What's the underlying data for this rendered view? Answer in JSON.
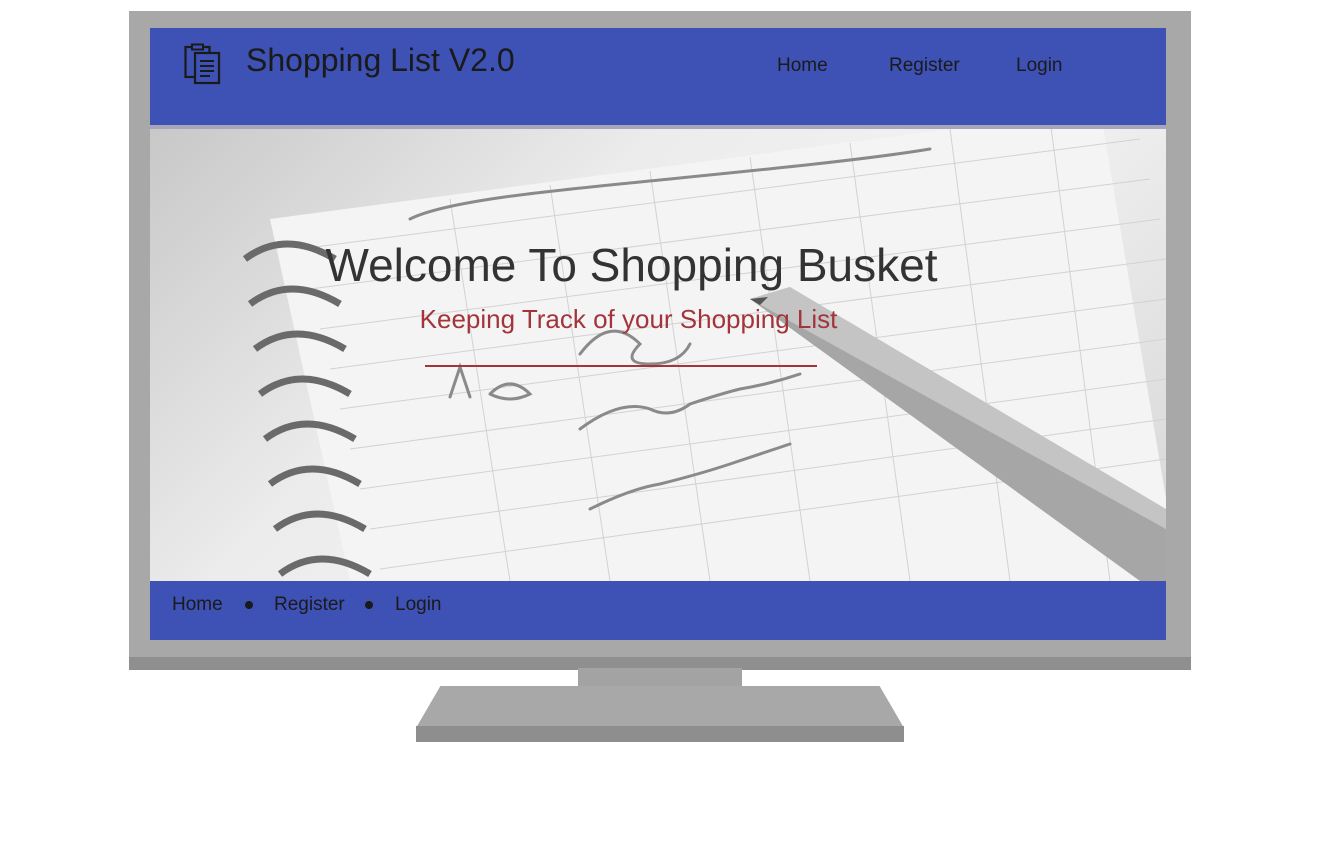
{
  "header": {
    "title": "Shopping List V2.0",
    "logo_icon": "clipboard-list-icon",
    "nav": [
      {
        "label": "Home"
      },
      {
        "label": "Register"
      },
      {
        "label": "Login"
      }
    ]
  },
  "hero": {
    "title": "Welcome To Shopping Busket",
    "subtitle": "Keeping Track of your Shopping List",
    "accent_color": "#a3343a"
  },
  "footer": {
    "nav": [
      {
        "label": "Home"
      },
      {
        "label": "Register"
      },
      {
        "label": "Login"
      }
    ]
  },
  "colors": {
    "brand": "#3e51b5",
    "monitor": "#a8a8a8"
  }
}
